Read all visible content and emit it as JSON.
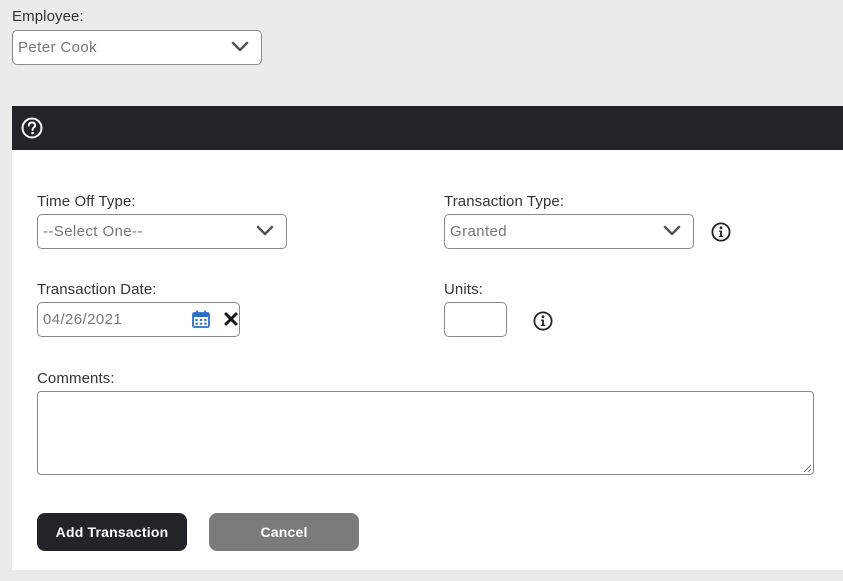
{
  "employee": {
    "label": "Employee:",
    "selected": "Peter Cook"
  },
  "form": {
    "time_off_type": {
      "label": "Time Off Type:",
      "selected": "--Select One--"
    },
    "transaction_type": {
      "label": "Transaction Type:",
      "selected": "Granted"
    },
    "transaction_date": {
      "label": "Transaction Date:",
      "value": "04/26/2021"
    },
    "units": {
      "label": "Units:",
      "value": ""
    },
    "comments": {
      "label": "Comments:",
      "value": ""
    }
  },
  "buttons": {
    "add_label": "Add Transaction",
    "cancel_label": "Cancel"
  },
  "icons": {
    "help": "help-circle-icon",
    "info": "info-circle-icon",
    "calendar": "calendar-icon",
    "clear": "close-x-icon",
    "dropdown": "chevron-down-icon"
  },
  "colors": {
    "header_bar": "#212429",
    "primary_button": "#212429",
    "secondary_button": "#7b7b7b",
    "calendar_icon": "#2a6fc9",
    "page_background": "#ebebeb"
  }
}
